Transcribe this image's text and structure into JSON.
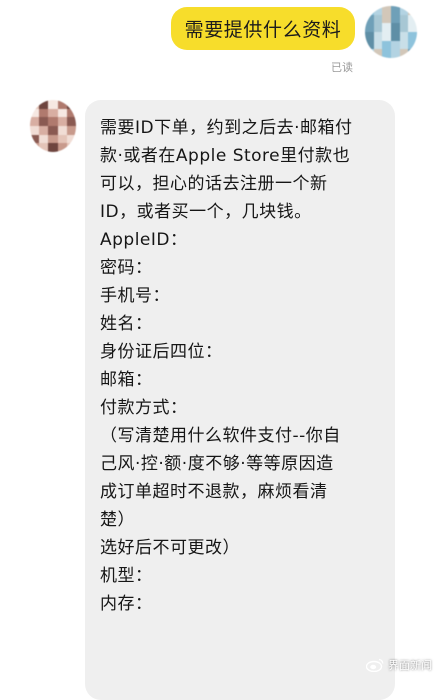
{
  "outgoing": {
    "text": "需要提供什么资料",
    "read_status": "已读"
  },
  "incoming": {
    "lines": [
      "需要ID下单，约到之后去·邮箱付",
      "款·或者在Apple Store里付款也",
      "可以，担心的话去注册一个新",
      "ID，或者买一个，几块钱。",
      "",
      "AppleID：",
      "密码：",
      "手机号：",
      "姓名：",
      "身份证后四位：",
      "邮箱：",
      "付款方式：",
      "（写清楚用什么软件支付--你自",
      "己风·控·额·度不够·等等原因造",
      "成订单超时不退款，麻烦看清",
      "楚）",
      "选好后不可更改）",
      "",
      "机型：",
      "内存："
    ]
  },
  "watermark": {
    "text": "界面新闻",
    "icon": "weibo-icon"
  },
  "colors": {
    "outgoing_bubble": "#f7dd2b",
    "incoming_bubble": "#efefef",
    "read_status": "#9a9a9a"
  }
}
